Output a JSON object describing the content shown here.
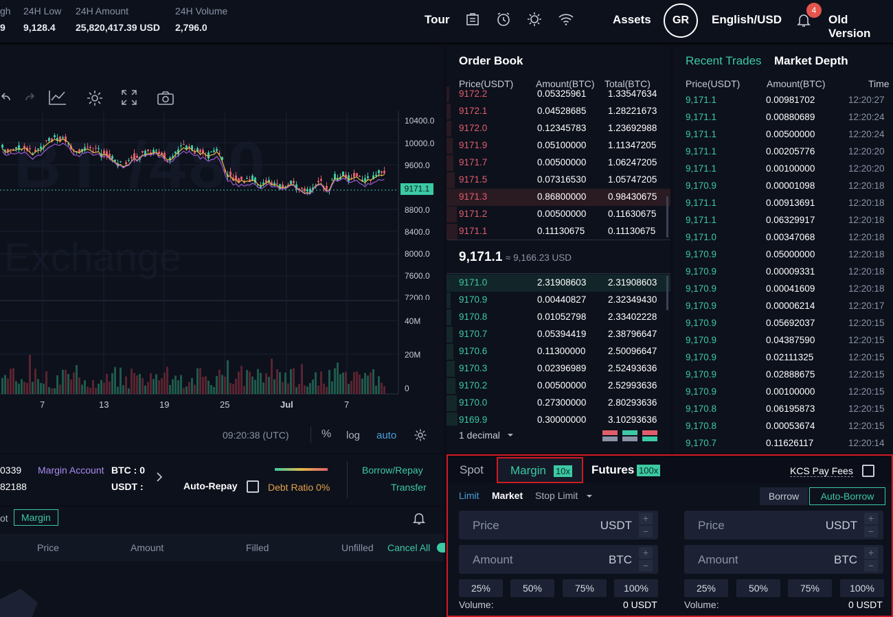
{
  "header": {
    "stats": [
      {
        "label": "gh",
        "value": "9"
      },
      {
        "label": "24H Low",
        "value": "9,128.4"
      },
      {
        "label": "24H Amount",
        "value": "25,820,417.39 USD"
      },
      {
        "label": "24H Volume",
        "value": "2,796.0"
      }
    ],
    "tour": "Tour",
    "assets": "Assets",
    "avatar": "GR",
    "language": "English/USD",
    "notifications": "4",
    "old_version": "Old Version"
  },
  "chart": {
    "watermark_top": "BT /480",
    "watermark_bottom": "Exchange",
    "price_ticks": [
      "10400.0",
      "10000.0",
      "9600.0",
      "9171.1",
      "8800.0",
      "8400.0",
      "8000.0",
      "7600.0",
      "7200.0"
    ],
    "volume_ticks": [
      "40M",
      "20M",
      "0"
    ],
    "date_ticks": [
      "7",
      "13",
      "19",
      "25",
      "Jul",
      "7"
    ],
    "current_price_label": "9171.1",
    "time": "09:20:38 (UTC)",
    "scale_options": [
      "%",
      "log",
      "auto"
    ],
    "accent": "#3cc9a4",
    "down_color": "#e05e6b"
  },
  "orderbook": {
    "title": "Order Book",
    "columns": [
      "Price(USDT)",
      "Amount(BTC)",
      "Total(BTC)"
    ],
    "asks": [
      {
        "price": "9172.2",
        "amount": "0.05325961",
        "total": "1.33547634"
      },
      {
        "price": "9172.1",
        "amount": "0.04528685",
        "total": "1.28221673"
      },
      {
        "price": "9172.0",
        "amount": "0.12345783",
        "total": "1.23692988"
      },
      {
        "price": "9171.9",
        "amount": "0.05100000",
        "total": "1.11347205"
      },
      {
        "price": "9171.7",
        "amount": "0.00500000",
        "total": "1.06247205"
      },
      {
        "price": "9171.5",
        "amount": "0.07316530",
        "total": "1.05747205"
      },
      {
        "price": "9171.3",
        "amount": "0.86800000",
        "total": "0.98430675"
      },
      {
        "price": "9171.2",
        "amount": "0.00500000",
        "total": "0.11630675"
      },
      {
        "price": "9171.1",
        "amount": "0.11130675",
        "total": "0.11130675"
      }
    ],
    "last_price": "9,171.1",
    "last_price_usd": "≈ 9,166.23 USD",
    "bids": [
      {
        "price": "9171.0",
        "amount": "2.31908603",
        "total": "2.31908603"
      },
      {
        "price": "9170.9",
        "amount": "0.00440827",
        "total": "2.32349430"
      },
      {
        "price": "9170.8",
        "amount": "0.01052798",
        "total": "2.33402228"
      },
      {
        "price": "9170.7",
        "amount": "0.05394419",
        "total": "2.38796647"
      },
      {
        "price": "9170.6",
        "amount": "0.11300000",
        "total": "2.50096647"
      },
      {
        "price": "9170.3",
        "amount": "0.02396989",
        "total": "2.52493636"
      },
      {
        "price": "9170.2",
        "amount": "0.00500000",
        "total": "2.52993636"
      },
      {
        "price": "9170.0",
        "amount": "0.27300000",
        "total": "2.80293636"
      },
      {
        "price": "9169.9",
        "amount": "0.30000000",
        "total": "3.10293636"
      }
    ],
    "decimal": "1 decimal"
  },
  "trades": {
    "tab_recent": "Recent Trades",
    "tab_depth": "Market Depth",
    "columns": [
      "Price(USDT)",
      "Amount(BTC)",
      "Time"
    ],
    "rows": [
      {
        "price": "9,171.1",
        "amount": "0.00981702",
        "time": "12:20:27"
      },
      {
        "price": "9,171.1",
        "amount": "0.00880689",
        "time": "12:20:24"
      },
      {
        "price": "9,171.1",
        "amount": "0.00500000",
        "time": "12:20:24"
      },
      {
        "price": "9,171.1",
        "amount": "0.00205776",
        "time": "12:20:20"
      },
      {
        "price": "9,171.1",
        "amount": "0.00100000",
        "time": "12:20:20"
      },
      {
        "price": "9,170.9",
        "amount": "0.00001098",
        "time": "12:20:18"
      },
      {
        "price": "9,171.1",
        "amount": "0.00913691",
        "time": "12:20:18"
      },
      {
        "price": "9,171.1",
        "amount": "0.06329917",
        "time": "12:20:18"
      },
      {
        "price": "9,171.0",
        "amount": "0.00347068",
        "time": "12:20:18"
      },
      {
        "price": "9,170.9",
        "amount": "0.05000000",
        "time": "12:20:18"
      },
      {
        "price": "9,170.9",
        "amount": "0.00009331",
        "time": "12:20:18"
      },
      {
        "price": "9,170.9",
        "amount": "0.00041609",
        "time": "12:20:18"
      },
      {
        "price": "9,170.9",
        "amount": "0.00006214",
        "time": "12:20:17"
      },
      {
        "price": "9,170.9",
        "amount": "0.05692037",
        "time": "12:20:15"
      },
      {
        "price": "9,170.9",
        "amount": "0.04387590",
        "time": "12:20:15"
      },
      {
        "price": "9,170.9",
        "amount": "0.02111325",
        "time": "12:20:15"
      },
      {
        "price": "9,170.9",
        "amount": "0.02888675",
        "time": "12:20:15"
      },
      {
        "price": "9,170.9",
        "amount": "0.00100000",
        "time": "12:20:15"
      },
      {
        "price": "9,170.8",
        "amount": "0.06195873",
        "time": "12:20:15"
      },
      {
        "price": "9,170.8",
        "amount": "0.00053674",
        "time": "12:20:15"
      },
      {
        "price": "9,170.7",
        "amount": "0.11626117",
        "time": "12:20:14"
      }
    ]
  },
  "margin_info": {
    "left_value_1": "0339",
    "left_value_2": "82188",
    "account_label": "Margin Account",
    "btc": "BTC : 0",
    "usdt": "USDT :",
    "auto_repay": "Auto-Repay",
    "debt_ratio": "Debt Ratio 0%",
    "borrow_repay": "Borrow/Repay",
    "transfer": "Transfer"
  },
  "orders": {
    "tab_spot": "ot",
    "tab_margin": "Margin",
    "columns": [
      "Price",
      "Amount",
      "Filled",
      "Unfilled"
    ],
    "cancel_all": "Cancel All"
  },
  "trade_form": {
    "tabs": [
      {
        "label": "Spot"
      },
      {
        "label": "Margin",
        "badge": "10x"
      },
      {
        "label": "Futures",
        "badge": "100x"
      }
    ],
    "kcs_fees": "KCS Pay Fees",
    "order_types": [
      "Limit",
      "Market",
      "Stop Limit"
    ],
    "borrow": "Borrow",
    "auto_borrow": "Auto-Borrow",
    "price_placeholder": "Price",
    "price_unit": "USDT",
    "amount_placeholder": "Amount",
    "amount_unit": "BTC",
    "percents": [
      "25%",
      "50%",
      "75%",
      "100%"
    ],
    "volume_label": "Volume:",
    "volume_value": "0 USDT"
  }
}
